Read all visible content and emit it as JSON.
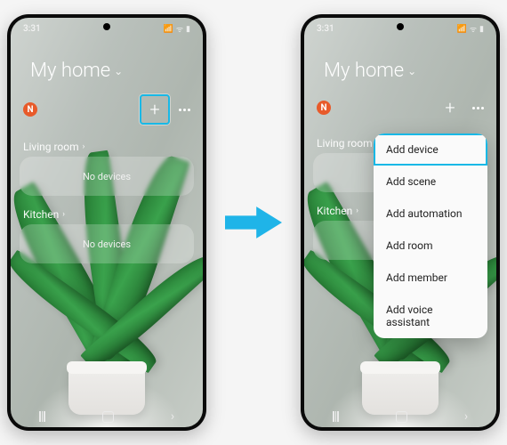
{
  "status": {
    "time": "3:31",
    "icons": "▾ ▫ ▯"
  },
  "header": {
    "title": "My home"
  },
  "badge": {
    "letter": "N"
  },
  "actions": {
    "plus": "+"
  },
  "sections": [
    {
      "label": "Living room",
      "card": "No devices"
    },
    {
      "label": "Kitchen",
      "card": "No devices"
    }
  ],
  "menu": {
    "items": [
      "Add device",
      "Add scene",
      "Add automation",
      "Add room",
      "Add member",
      "Add voice assistant"
    ]
  }
}
